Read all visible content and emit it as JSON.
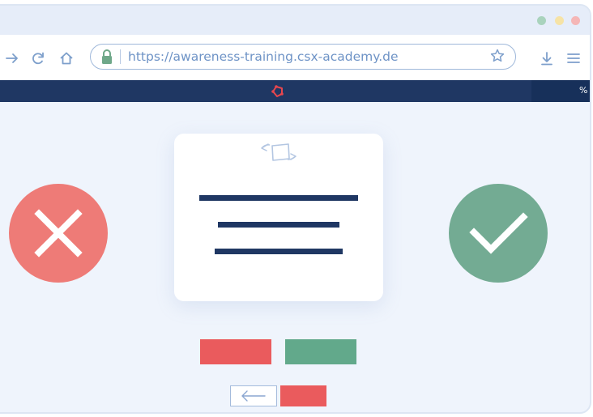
{
  "browser": {
    "url": "https://awareness-training.csx-academy.de",
    "colors": {
      "titlebar": "#e6edf9",
      "url_text": "#6e93c6"
    }
  },
  "app_header": {
    "progress_label": "%",
    "colors": {
      "bar": "#1f3763",
      "logo": "#e8474e"
    }
  },
  "icons": {
    "toolbar": [
      "forward-arrow-icon",
      "reload-icon",
      "home-icon",
      "lock-icon",
      "star-icon",
      "download-icon",
      "menu-icon"
    ],
    "card": "swipe-card-icon",
    "reject": "x-icon",
    "accept": "check-icon"
  },
  "colors": {
    "reject": "#ee7b77",
    "accept": "#73ab93",
    "red_button": "#ea5b5d",
    "green_button": "#62a98b",
    "text_placeholder": "#1f3763"
  }
}
